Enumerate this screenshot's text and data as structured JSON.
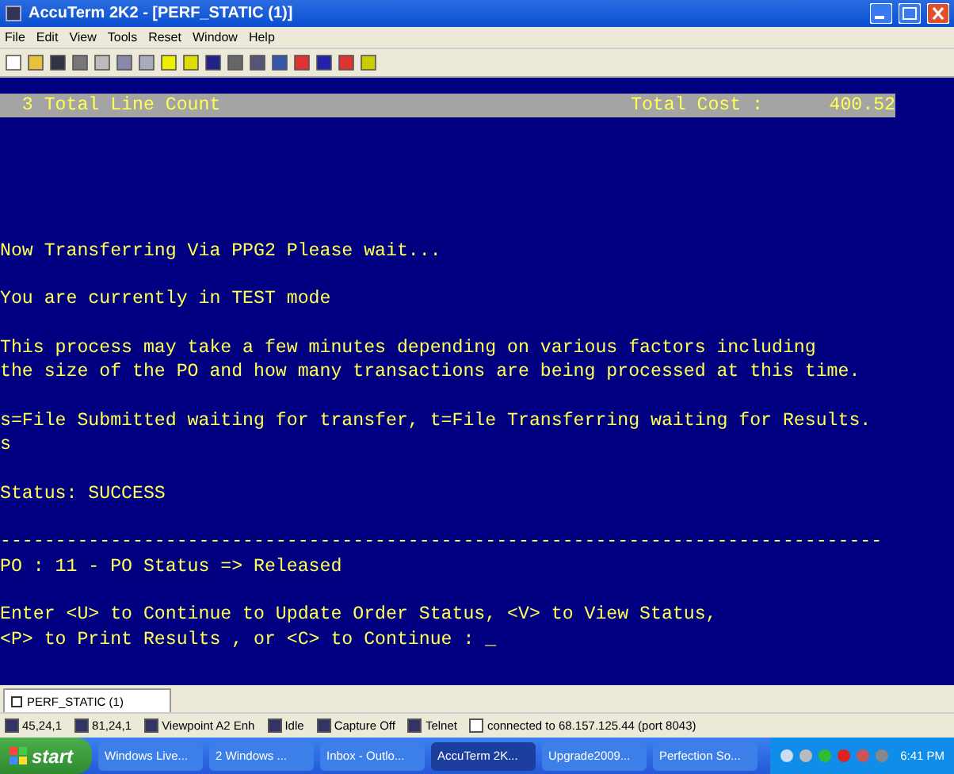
{
  "window": {
    "title": "AccuTerm 2K2 - [PERF_STATIC (1)]"
  },
  "menu": [
    "File",
    "Edit",
    "View",
    "Tools",
    "Reset",
    "Window",
    "Help"
  ],
  "terminal": {
    "header": {
      "left": "  3 Total Line Count",
      "right": "Total Cost :      400.52"
    },
    "blocks": [
      [
        "Now Transferring Via PPG2 Please wait..."
      ],
      [
        "You are currently in TEST mode"
      ],
      [
        "This process may take a few minutes depending on various factors including",
        "the size of the PO and how many transactions are being processed at this time."
      ],
      [
        "s=File Submitted waiting for transfer, t=File Transferring waiting for Results.",
        "s"
      ],
      [
        "Status: SUCCESS"
      ],
      [
        "--------------------------------------------------------------------------------",
        "PO : 11 - PO Status => Released"
      ],
      [
        "Enter <U> to Continue to Update Order Status, <V> to View Status,",
        "<P> to Print Results , or <C> to Continue : _"
      ]
    ]
  },
  "document_tab": {
    "label": "PERF_STATIC (1)"
  },
  "status_bar": [
    "45,24,1",
    "81,24,1",
    "Viewpoint A2 Enh",
    "Idle",
    "Capture Off",
    "Telnet",
    "connected to 68.157.125.44 (port 8043)"
  ],
  "taskbar": {
    "start": "start",
    "items": [
      {
        "label": "Windows Live...",
        "selected": false
      },
      {
        "label": "2 Windows ...",
        "selected": false
      },
      {
        "label": "Inbox - Outlo...",
        "selected": false
      },
      {
        "label": "AccuTerm 2K...",
        "selected": true
      },
      {
        "label": "Upgrade2009...",
        "selected": false
      },
      {
        "label": "Perfection So...",
        "selected": false
      }
    ],
    "clock": "6:41 PM"
  }
}
